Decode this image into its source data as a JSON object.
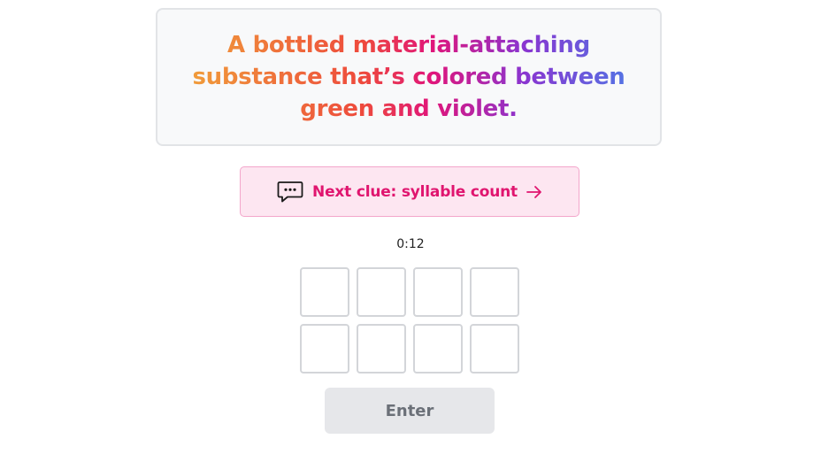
{
  "clue": {
    "text": "A bottled material-attaching substance that’s colored between green and violet.",
    "gradient_colors": [
      "#f0a23a",
      "#ee4a3c",
      "#e0157a",
      "#8a35d0",
      "#4e7ae6"
    ]
  },
  "next_clue": {
    "icon": "chat-bubble-icon",
    "label": "Next clue: syllable count",
    "arrow_icon": "arrow-right-icon",
    "color": "#e0156f",
    "background": "#fde6f1"
  },
  "timer": {
    "value": "0:12"
  },
  "answer_grid": {
    "rows": 2,
    "columns": 4,
    "letters": [
      "",
      "",
      "",
      "",
      "",
      "",
      "",
      ""
    ]
  },
  "enter_button": {
    "label": "Enter",
    "state": "disabled"
  }
}
